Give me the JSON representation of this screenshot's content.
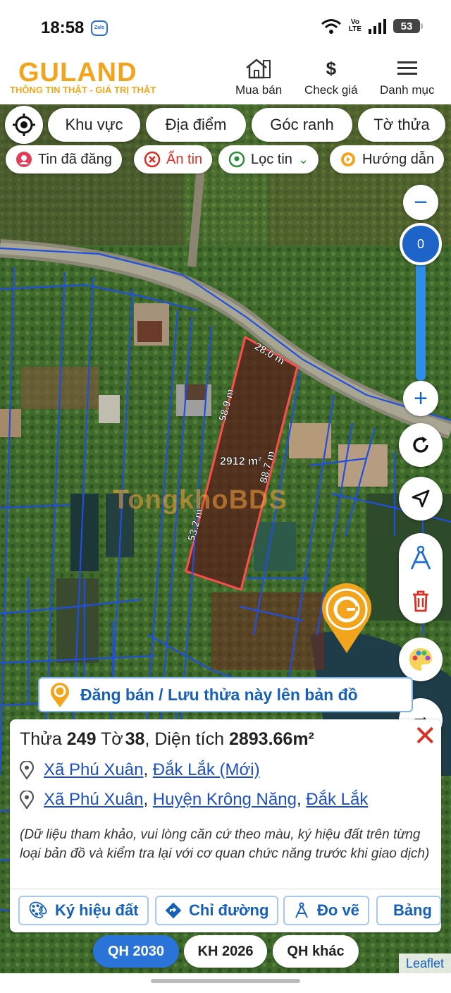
{
  "status_bar": {
    "time": "18:58",
    "app_icon": "Zalo",
    "network_top": "Vo",
    "network_bottom": "LTE",
    "battery": "53"
  },
  "header": {
    "logo": "GULAND",
    "slogan": "THÔNG TIN THẬT - GIÁ TRỊ THẬT",
    "nav": [
      {
        "label": "Mua bán",
        "icon": "house-icon"
      },
      {
        "label": "Check giá",
        "icon": "dollar-icon"
      },
      {
        "label": "Danh mục",
        "icon": "menu-icon"
      }
    ]
  },
  "filters": {
    "chips": [
      "Khu vực",
      "Địa điểm",
      "Góc ranh",
      "Tờ thửa"
    ]
  },
  "actions": {
    "posted": "Tin đã đăng",
    "hidden": "Ẩn tin",
    "filter": "Lọc tin",
    "guide": "Hướng dẫn"
  },
  "zoom": {
    "level": "0"
  },
  "parcel": {
    "top_edge": "28.0 m",
    "left_edge_top": "58.9 m",
    "right_edge": "88.7 m",
    "left_edge_bottom": "53.2 m",
    "area_label": "2912 m²"
  },
  "watermark": "TongkhoBDS",
  "post_bar": {
    "label": "Đăng bán / Lưu thửa này lên bản đồ"
  },
  "info": {
    "prefix_plot": "Thửa",
    "plot": "249",
    "prefix_sheet": "Tờ",
    "sheet": "38",
    "prefix_area": ", Diện tích",
    "area": "2893.66m²",
    "address_new": {
      "commune": "Xã Phú Xuân",
      "province": "Đắk Lắk (Mới)"
    },
    "address_old": {
      "commune": "Xã Phú Xuân",
      "district": "Huyện Krông Năng",
      "province": "Đắk Lắk"
    },
    "note": "(Dữ liệu tham khảo, vui lòng căn cứ theo màu, ký hiệu đất trên từng loại bản đồ và kiểm tra lại với cơ quan chức năng trước khi giao dịch)",
    "buttons": [
      "Ký hiệu đất",
      "Chỉ đường",
      "Đo vẽ",
      "Bảng"
    ]
  },
  "layers": [
    {
      "label": "QH 2030",
      "active": true
    },
    {
      "label": "KH 2026",
      "active": false
    },
    {
      "label": "QH khác",
      "active": false
    }
  ],
  "attribution": "Leaflet",
  "colors": {
    "brand": "#f2a51c",
    "link": "#1d4fc4",
    "active_layer": "#2a73d8",
    "parcel_outline": "#ff4d4d",
    "boundary": "#1f4fe0"
  }
}
